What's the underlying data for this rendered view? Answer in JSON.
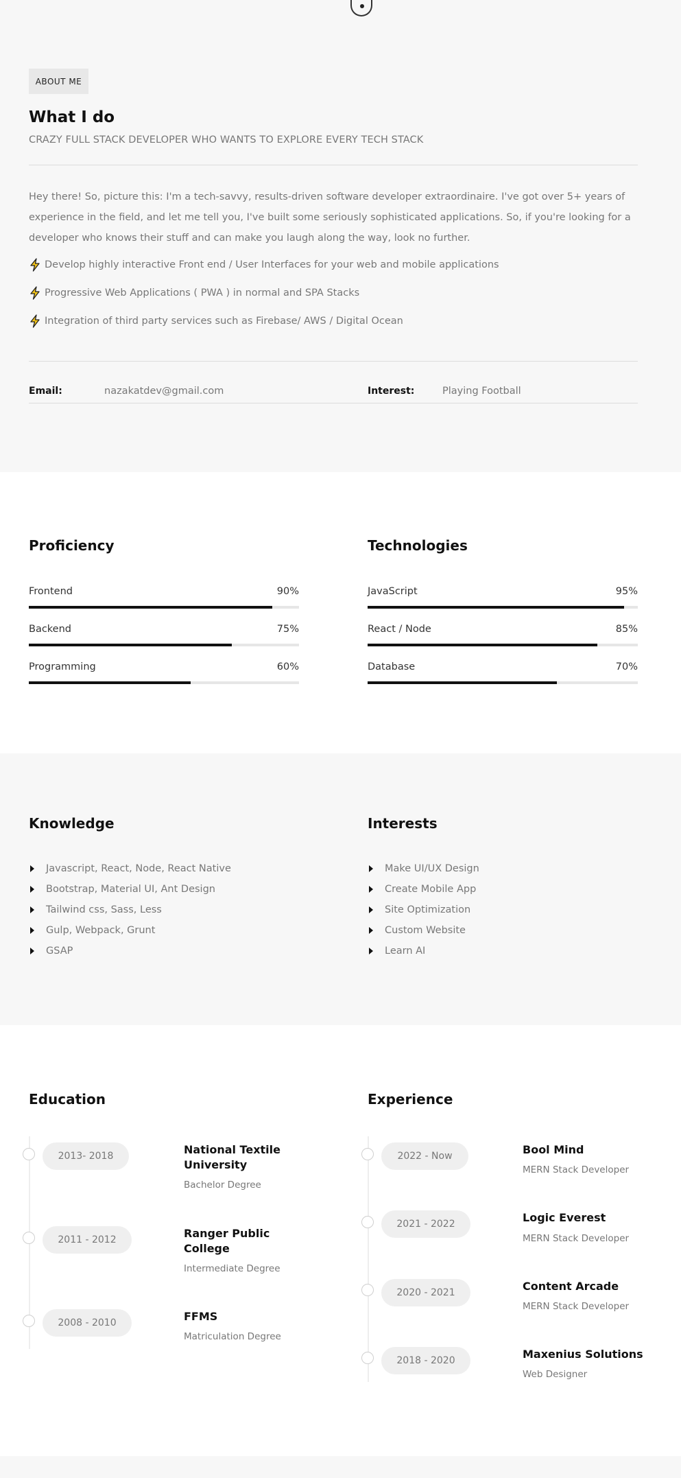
{
  "about": {
    "badge": "ABOUT ME",
    "title": "What I do",
    "subtitle": "CRAZY FULL STACK DEVELOPER WHO WANTS TO EXPLORE EVERY TECH STACK",
    "intro": "Hey there! So, picture this: I'm a tech-savvy, results-driven software developer extraordinaire. I've got over 5+ years of experience in the field, and let me tell you, I've built some seriously sophisticated applications. So, if you're looking for a developer who knows their stuff and can make you laugh along the way, look no further.",
    "bullets": [
      {
        "icon": "lightning-icon",
        "text": "Develop highly interactive Front end / User Interfaces for your web and mobile applications"
      },
      {
        "icon": "lightning-icon",
        "text": "Progressive Web Applications ( PWA ) in normal and SPA Stacks"
      },
      {
        "icon": "lightning-icon",
        "text": "Integration of third party services such as Firebase/ AWS / Digital Ocean"
      }
    ],
    "email_label": "Email:",
    "email_value": "nazakatdev@gmail.com",
    "interest_label": "Interest:",
    "interest_value": "Playing Football"
  },
  "proficiency": {
    "title": "Proficiency",
    "items": [
      {
        "label": "Frontend",
        "pct": "90%",
        "value": 90
      },
      {
        "label": "Backend",
        "pct": "75%",
        "value": 75
      },
      {
        "label": "Programming",
        "pct": "60%",
        "value": 60
      }
    ]
  },
  "technologies": {
    "title": "Technologies",
    "items": [
      {
        "label": "JavaScript",
        "pct": "95%",
        "value": 95
      },
      {
        "label": "React / Node",
        "pct": "85%",
        "value": 85
      },
      {
        "label": "Database",
        "pct": "70%",
        "value": 70
      }
    ]
  },
  "knowledge": {
    "title": "Knowledge",
    "items": [
      "Javascript, React, Node, React Native",
      "Bootstrap, Material UI, Ant Design",
      "Tailwind css, Sass, Less",
      "Gulp, Webpack, Grunt",
      "GSAP"
    ]
  },
  "interests": {
    "title": "Interests",
    "items": [
      "Make UI/UX Design",
      "Create Mobile App",
      "Site Optimization",
      "Custom Website",
      "Learn AI"
    ]
  },
  "education": {
    "title": "Education",
    "items": [
      {
        "years": "2013- 2018",
        "name": "National Textile University",
        "degree": "Bachelor Degree"
      },
      {
        "years": "2011 - 2012",
        "name": "Ranger Public College",
        "degree": "Intermediate Degree"
      },
      {
        "years": "2008 - 2010",
        "name": "FFMS",
        "degree": "Matriculation Degree"
      }
    ]
  },
  "experience": {
    "title": "Experience",
    "items": [
      {
        "years": "2022 - Now",
        "name": "Bool Mind",
        "role": "MERN Stack Developer"
      },
      {
        "years": "2021 - 2022",
        "name": "Logic Everest",
        "role": "MERN Stack Developer"
      },
      {
        "years": "2020 - 2021",
        "name": "Content Arcade",
        "role": "MERN Stack Developer"
      },
      {
        "years": "2018 - 2020",
        "name": "Maxenius Solutions",
        "role": "Web Designer"
      }
    ]
  },
  "colors": {
    "accent": "#111111",
    "muted_text": "#777777",
    "section_bg": "#f7f7f7",
    "bolt": "#f5c518"
  }
}
